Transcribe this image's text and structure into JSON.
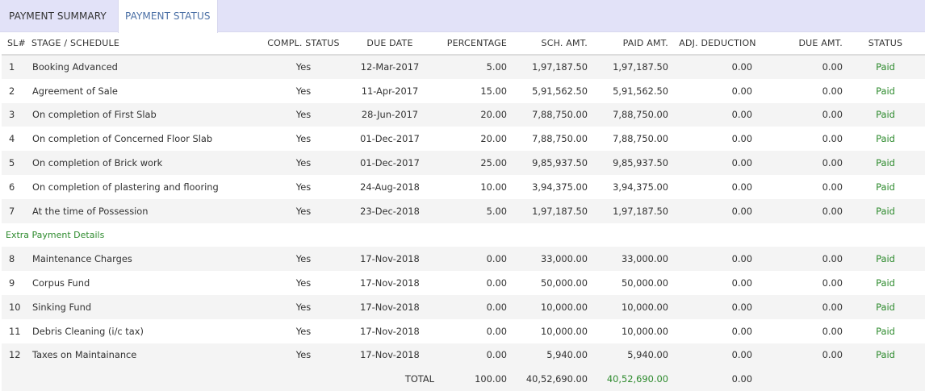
{
  "tabs": [
    {
      "label": "PAYMENT SUMMARY",
      "active": false
    },
    {
      "label": "PAYMENT STATUS",
      "active": true
    }
  ],
  "colors": {
    "accent_tab_text": "#4a6fa5",
    "tabbar_bg": "#e2e2f8",
    "paid_green": "#2e8b2e"
  },
  "table": {
    "headers": {
      "sl": "SL#",
      "stage": "STAGE / SCHEDULE",
      "compl": "COMPL. STATUS",
      "due_date": "DUE DATE",
      "percentage": "PERCENTAGE",
      "sch_amt": "SCH. AMT.",
      "paid_amt": "PAID AMT.",
      "adj_deduction": "ADJ. DEDUCTION",
      "due_amt": "DUE AMT.",
      "status": "STATUS"
    },
    "rows": [
      {
        "sl": "1",
        "stage": "Booking Advanced",
        "compl": "Yes",
        "due_date": "12-Mar-2017",
        "percentage": "5.00",
        "sch_amt": "1,97,187.50",
        "paid_amt": "1,97,187.50",
        "adj": "0.00",
        "due_amt": "0.00",
        "status": "Paid"
      },
      {
        "sl": "2",
        "stage": "Agreement of Sale",
        "compl": "Yes",
        "due_date": "11-Apr-2017",
        "percentage": "15.00",
        "sch_amt": "5,91,562.50",
        "paid_amt": "5,91,562.50",
        "adj": "0.00",
        "due_amt": "0.00",
        "status": "Paid"
      },
      {
        "sl": "3",
        "stage": "On completion of First Slab",
        "compl": "Yes",
        "due_date": "28-Jun-2017",
        "percentage": "20.00",
        "sch_amt": "7,88,750.00",
        "paid_amt": "7,88,750.00",
        "adj": "0.00",
        "due_amt": "0.00",
        "status": "Paid"
      },
      {
        "sl": "4",
        "stage": "On completion of Concerned Floor Slab",
        "compl": "Yes",
        "due_date": "01-Dec-2017",
        "percentage": "20.00",
        "sch_amt": "7,88,750.00",
        "paid_amt": "7,88,750.00",
        "adj": "0.00",
        "due_amt": "0.00",
        "status": "Paid"
      },
      {
        "sl": "5",
        "stage": "On completion of Brick work",
        "compl": "Yes",
        "due_date": "01-Dec-2017",
        "percentage": "25.00",
        "sch_amt": "9,85,937.50",
        "paid_amt": "9,85,937.50",
        "adj": "0.00",
        "due_amt": "0.00",
        "status": "Paid"
      },
      {
        "sl": "6",
        "stage": "On completion of plastering and flooring",
        "compl": "Yes",
        "due_date": "24-Aug-2018",
        "percentage": "10.00",
        "sch_amt": "3,94,375.00",
        "paid_amt": "3,94,375.00",
        "adj": "0.00",
        "due_amt": "0.00",
        "status": "Paid"
      },
      {
        "sl": "7",
        "stage": "At the time of Possession",
        "compl": "Yes",
        "due_date": "23-Dec-2018",
        "percentage": "5.00",
        "sch_amt": "1,97,187.50",
        "paid_amt": "1,97,187.50",
        "adj": "0.00",
        "due_amt": "0.00",
        "status": "Paid"
      }
    ],
    "extra_section_label": "Extra Payment Details",
    "extra_rows": [
      {
        "sl": "8",
        "stage": "Maintenance Charges",
        "compl": "Yes",
        "due_date": "17-Nov-2018",
        "percentage": "0.00",
        "sch_amt": "33,000.00",
        "paid_amt": "33,000.00",
        "adj": "0.00",
        "due_amt": "0.00",
        "status": "Paid"
      },
      {
        "sl": "9",
        "stage": "Corpus Fund",
        "compl": "Yes",
        "due_date": "17-Nov-2018",
        "percentage": "0.00",
        "sch_amt": "50,000.00",
        "paid_amt": "50,000.00",
        "adj": "0.00",
        "due_amt": "0.00",
        "status": "Paid"
      },
      {
        "sl": "10",
        "stage": "Sinking Fund",
        "compl": "Yes",
        "due_date": "17-Nov-2018",
        "percentage": "0.00",
        "sch_amt": "10,000.00",
        "paid_amt": "10,000.00",
        "adj": "0.00",
        "due_amt": "0.00",
        "status": "Paid"
      },
      {
        "sl": "11",
        "stage": "Debris Cleaning (i/c tax)",
        "compl": "Yes",
        "due_date": "17-Nov-2018",
        "percentage": "0.00",
        "sch_amt": "10,000.00",
        "paid_amt": "10,000.00",
        "adj": "0.00",
        "due_amt": "0.00",
        "status": "Paid"
      },
      {
        "sl": "12",
        "stage": "Taxes on Maintainance",
        "compl": "Yes",
        "due_date": "17-Nov-2018",
        "percentage": "0.00",
        "sch_amt": "5,940.00",
        "paid_amt": "5,940.00",
        "adj": "0.00",
        "due_amt": "0.00",
        "status": "Paid"
      }
    ],
    "total": {
      "label": "TOTAL",
      "percentage": "100.00",
      "sch_amt": "40,52,690.00",
      "paid_amt": "40,52,690.00",
      "adj": "0.00"
    }
  }
}
